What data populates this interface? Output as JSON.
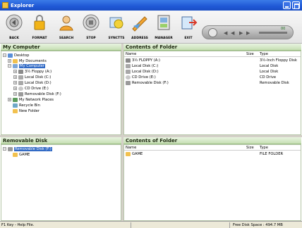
{
  "window": {
    "title": "Explorer"
  },
  "toolbar": {
    "buttons": [
      {
        "label": "BACK",
        "icon": "back-icon"
      },
      {
        "label": "FORMAT",
        "icon": "format-icon"
      },
      {
        "label": "SEARCH",
        "icon": "search-icon"
      },
      {
        "label": "STOP",
        "icon": "stop-icon"
      },
      {
        "label": "SYNCTTS",
        "icon": "sync-icon"
      },
      {
        "label": "ADDRESS",
        "icon": "address-icon"
      },
      {
        "label": "MANAGER",
        "icon": "manager-icon"
      },
      {
        "label": "EXIT",
        "icon": "exit-icon"
      }
    ],
    "media_time": "00"
  },
  "tree_pane": {
    "header": "My Computer",
    "items": [
      {
        "label": "Desktop",
        "expander": "−"
      },
      {
        "label": "My Documents",
        "expander": "+"
      },
      {
        "label": "My Computer",
        "expander": "−",
        "selected": true
      },
      {
        "label": "3½ Floppy (A:)",
        "expander": "+"
      },
      {
        "label": "Local Disk (C:)",
        "expander": "+"
      },
      {
        "label": "Local Disk (D:)",
        "expander": "+"
      },
      {
        "label": "CD Drive (E:)",
        "expander": "+"
      },
      {
        "label": "Removable Disk (F:)",
        "expander": "+"
      },
      {
        "label": "My Network Places",
        "expander": "+"
      },
      {
        "label": "Recycle Bin",
        "expander": ""
      },
      {
        "label": "New Folder",
        "expander": ""
      }
    ]
  },
  "contents_pane": {
    "header": "Contents of Folder",
    "columns": {
      "name": "Name",
      "size": "Size",
      "type": "Type"
    },
    "rows": [
      {
        "name": "3½ FLOPPY (A:)",
        "type": "3½-Inch Floppy Disk"
      },
      {
        "name": "Local Disk (C:)",
        "type": "Local Disk"
      },
      {
        "name": "Local Disk (D:)",
        "type": "Local Disk"
      },
      {
        "name": "CD Drive (E:)",
        "type": "CD Drive"
      },
      {
        "name": "Removable Disk (F:)",
        "type": "Removable Disk"
      }
    ]
  },
  "removable_pane": {
    "header": "Removable Disk",
    "items": [
      {
        "label": "Removable Disk (F:)",
        "expander": "−",
        "selected": true
      },
      {
        "label": "GAME",
        "expander": ""
      }
    ]
  },
  "contents_pane2": {
    "header": "Contents of Folder",
    "columns": {
      "name": "Name",
      "size": "Size",
      "type": "Type"
    },
    "rows": [
      {
        "name": "GAME",
        "type": "FILE FOLDER"
      }
    ]
  },
  "status": {
    "help": "F1 Key - Help File.",
    "free_space": "Free Disk Space : 494.7 MB"
  },
  "colors": {
    "title_bar": "#1f58d6",
    "pane_header": "#c6dfb4",
    "selection": "#316ac5"
  }
}
